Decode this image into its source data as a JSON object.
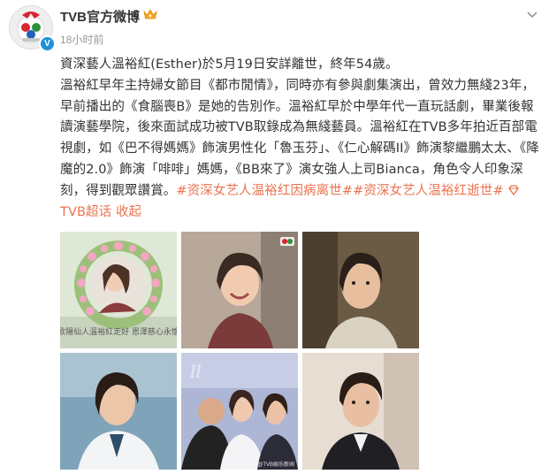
{
  "post": {
    "username": "TVB官方微博",
    "timestamp": "18小时前",
    "verified_badge": "V",
    "crown_icon": "crown-icon",
    "more_icon": "chevron-down-icon"
  },
  "content": {
    "paragraph_1": "資深藝人溫裕紅(Esther)於5月19日安詳離世，終年54歲。",
    "paragraph_2": "溫裕紅早年主持婦女節目《都市閒情》，同時亦有參與劇集演出，曾效力無綫23年，早前播出的《食腦喪B》是她的告別作。溫裕紅早於中學年代一直玩話劇，畢業後報讀演藝學院，後來面試成功被TVB取錄成為無綫藝員。溫裕紅在TVB多年拍近百部電視劇，如《巴不得媽媽》飾演男性化「魯玉芬」、《仁心解碼II》飾演黎繼鵬太太、《降魔的2.0》飾演「啡啡」媽媽，《BB來了》演女強人上司Bianca，角色令人印象深刻，得到觀眾讚賞。",
    "hashtag_1": "#资深女艺人温裕红因病离世#",
    "hashtag_2": "#资深女艺人温裕红逝世#",
    "supertopic": "TVB超话",
    "collapse": "收起"
  },
  "gallery": {
    "images": [
      {
        "name": "memorial-photo",
        "caption": "歐陽仙人溫裕紅走好 恩澤慈心永懷"
      },
      {
        "name": "smiling-actress-photo",
        "watermark": ""
      },
      {
        "name": "drama-still-photo"
      },
      {
        "name": "hospital-drama-photo"
      },
      {
        "name": "group-event-photo",
        "watermark": "@TVB娱乐新闻"
      },
      {
        "name": "office-drama-photo"
      }
    ]
  },
  "colors": {
    "link": "#eb7350",
    "text": "#333333",
    "secondary": "#999999",
    "verified": "#1e90d6"
  }
}
